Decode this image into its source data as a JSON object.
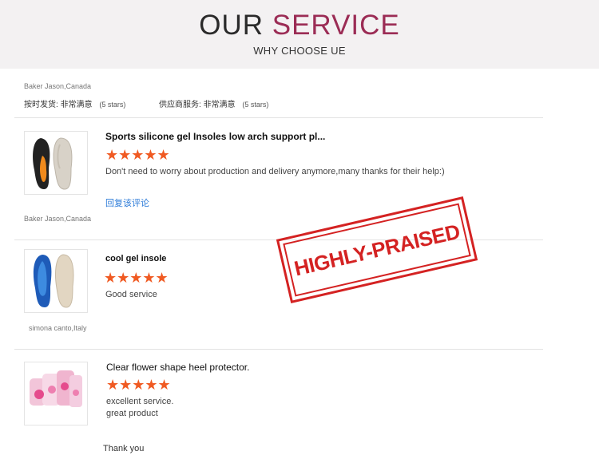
{
  "header": {
    "title_plain": "OUR",
    "title_accent": "SERVICE",
    "subtitle": "WHY CHOOSE UE"
  },
  "summary": {
    "reviewer": "Baker Jason,Canada",
    "shipping_label": "按时发货:",
    "shipping_value": "非常满意",
    "shipping_stars": "(5 stars)",
    "supplier_label": "供应商服务:",
    "supplier_value": "非常满意",
    "supplier_stars": "(5 stars)"
  },
  "reviews": [
    {
      "product_title": "Sports silicone gel Insoles low arch support pl...",
      "stars": "★★★★★",
      "rating": 5,
      "text": "Don't need to worry about production and delivery anymore,many thanks for their help:)",
      "reply_link": "回复该评论",
      "reviewer": "Baker Jason,Canada"
    },
    {
      "product_title": "cool gel insole",
      "stars": "★★★★★",
      "rating": 5,
      "text": "Good service",
      "reviewer": "simona canto,Italy"
    },
    {
      "product_title": "Clear flower shape heel protector.",
      "stars": "★★★★★",
      "rating": 5,
      "text_line1": "excellent service.",
      "text_line2": "great product"
    }
  ],
  "stamp": {
    "text": "HIGHLY-PRAISED"
  },
  "footer": {
    "thanks": "Thank you"
  },
  "colors": {
    "accent": "#9b2c55",
    "star": "#f05a22",
    "link": "#2c7bd8",
    "stamp": "#d42222"
  }
}
